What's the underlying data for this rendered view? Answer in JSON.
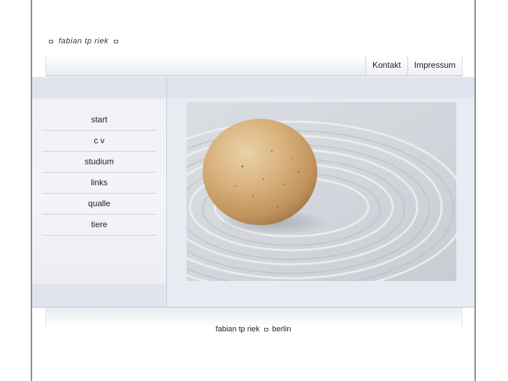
{
  "header": {
    "site_title": "fabian tp riek"
  },
  "topnav": {
    "items": [
      {
        "label": "Kontakt"
      },
      {
        "label": "Impressum"
      }
    ]
  },
  "sidebar": {
    "items": [
      {
        "label": "start"
      },
      {
        "label": "c v"
      },
      {
        "label": "studium"
      },
      {
        "label": "links"
      },
      {
        "label": "qualle"
      },
      {
        "label": "tiere"
      }
    ]
  },
  "footer": {
    "name": "fabian tp riek",
    "city": "berlin"
  },
  "colors": {
    "border": "#8c8c8c",
    "panel": "#e9ebf2",
    "sand": "#d4d7dd",
    "stone": "#cfa878"
  }
}
